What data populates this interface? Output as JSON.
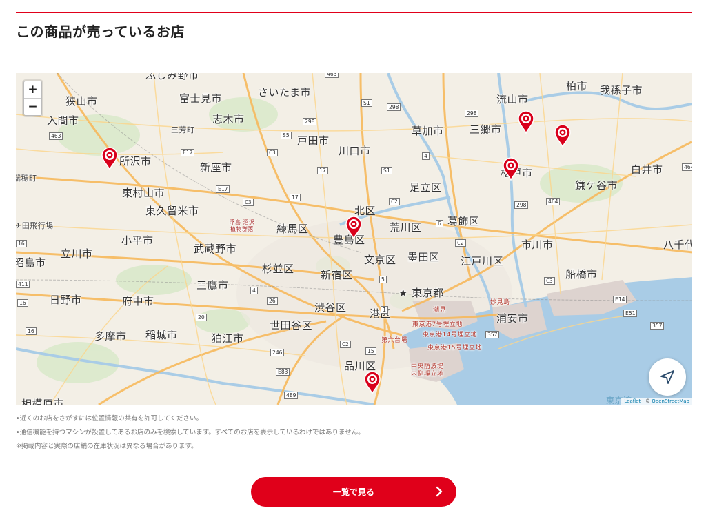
{
  "section": {
    "title": "この商品が売っているお店"
  },
  "map": {
    "zoom_in": "+",
    "zoom_out": "−",
    "labels": {
      "fujimino": "ふじみ野市",
      "sayama": "狭山市",
      "fujimi": "富士見市",
      "saitama": "さいたま市",
      "nagareyama": "流山市",
      "kashiwa": "柏市",
      "abiko": "我孫子市",
      "iruma": "入間市",
      "miyoshi": "三芳町",
      "shiki": "志木市",
      "toda": "戸田市",
      "soka": "草加市",
      "misato": "三郷市",
      "tokorozawa": "所沢市",
      "niiza": "新座市",
      "kawaguchi": "川口市",
      "matsudo": "松戸市",
      "shiroi": "白井市",
      "mizuho": "瑞穂町",
      "higashimurayama": "東村山市",
      "adachi": "足立区",
      "kamagaya": "鎌ケ谷市",
      "higashikurume": "東久留米市",
      "kita": "北区",
      "nerima": "練馬区",
      "arakawa": "荒川区",
      "katsushika": "葛飾区",
      "kodaira": "小平市",
      "toshima": "豊島区",
      "ichikawa": "市川市",
      "yachiyo": "八千代",
      "tachikawa": "立川市",
      "musashino": "武蔵野市",
      "bunkyo": "文京区",
      "sumida": "墨田区",
      "edogawa": "江戸川区",
      "akishima": "昭島市",
      "suginami": "杉並区",
      "shinjuku": "新宿区",
      "funabashi": "船橋市",
      "mitaka": "三鷹市",
      "tokyo_to": "東京都",
      "hino": "日野市",
      "fuchu": "府中市",
      "shibuya": "渋谷区",
      "minato": "港区",
      "urayasu": "浦安市",
      "setagaya": "世田谷区",
      "tama": "多摩市",
      "inagi": "稲城市",
      "komae": "狛江市",
      "shinagawa": "品川区",
      "sagamihara": "相模原市",
      "airfield": "田飛行場",
      "park": "浮島 沼沢 植物群落",
      "port_shiomi": "潮見",
      "port_7": "東京港7号埋立地",
      "port_14": "東京港14号埋立地",
      "port_15": "東京港15号埋立地",
      "port_6": "第六台場",
      "port_chuo": "中央防波堤 内側埋立地",
      "myoken": "妙見島",
      "sea": "東京湾"
    },
    "routes": {
      "r463a": "463",
      "r463b": "463",
      "r463c": "463",
      "rS1a": "S1",
      "rS1b": "S1",
      "r298a": "298",
      "r298b": "298",
      "r298c": "298",
      "rS5": "S5",
      "rC3a": "C3",
      "rC3b": "C3",
      "rE17a": "E17",
      "rE17b": "E17",
      "r17a": "17",
      "r17b": "17",
      "rC2a": "C2",
      "rC2b": "C2",
      "rC2c": "C2",
      "r4a": "4",
      "r4b": "4",
      "r6a": "6",
      "r6b": "6",
      "r464a": "464",
      "r464b": "464",
      "r16a": "16",
      "r16b": "16",
      "r16c": "16",
      "r411": "411",
      "r20": "20",
      "r26": "26",
      "r5": "5",
      "r1": "1",
      "r15": "15",
      "r246": "246",
      "rE83": "E83",
      "r489": "489",
      "r357a": "357",
      "r357b": "357",
      "rE14": "E14",
      "rE51": "E51"
    },
    "attribution": {
      "leaflet": "Leaflet",
      "sep": " | © ",
      "osm": "OpenStreetMap"
    },
    "colors": {
      "land": "#f3efe6",
      "water": "#a9cce6",
      "pin": "#d9001b",
      "road_major": "#f7b95c"
    },
    "icons": [
      "zoom-in-icon",
      "zoom-out-icon",
      "store-pin-icon",
      "locate-arrow-icon",
      "chevron-right-icon"
    ]
  },
  "notes": [
    "•近くのお店をさがすには位置情報の共有を許可してください。",
    "•通信機能を持つマシンが設置してあるお店のみを検索しています。すべてのお店を表示しているわけではありません。",
    "※掲載内容と実際の店舗の在庫状況は異なる場合があります。"
  ],
  "cta": {
    "label": "一覧で見る"
  }
}
